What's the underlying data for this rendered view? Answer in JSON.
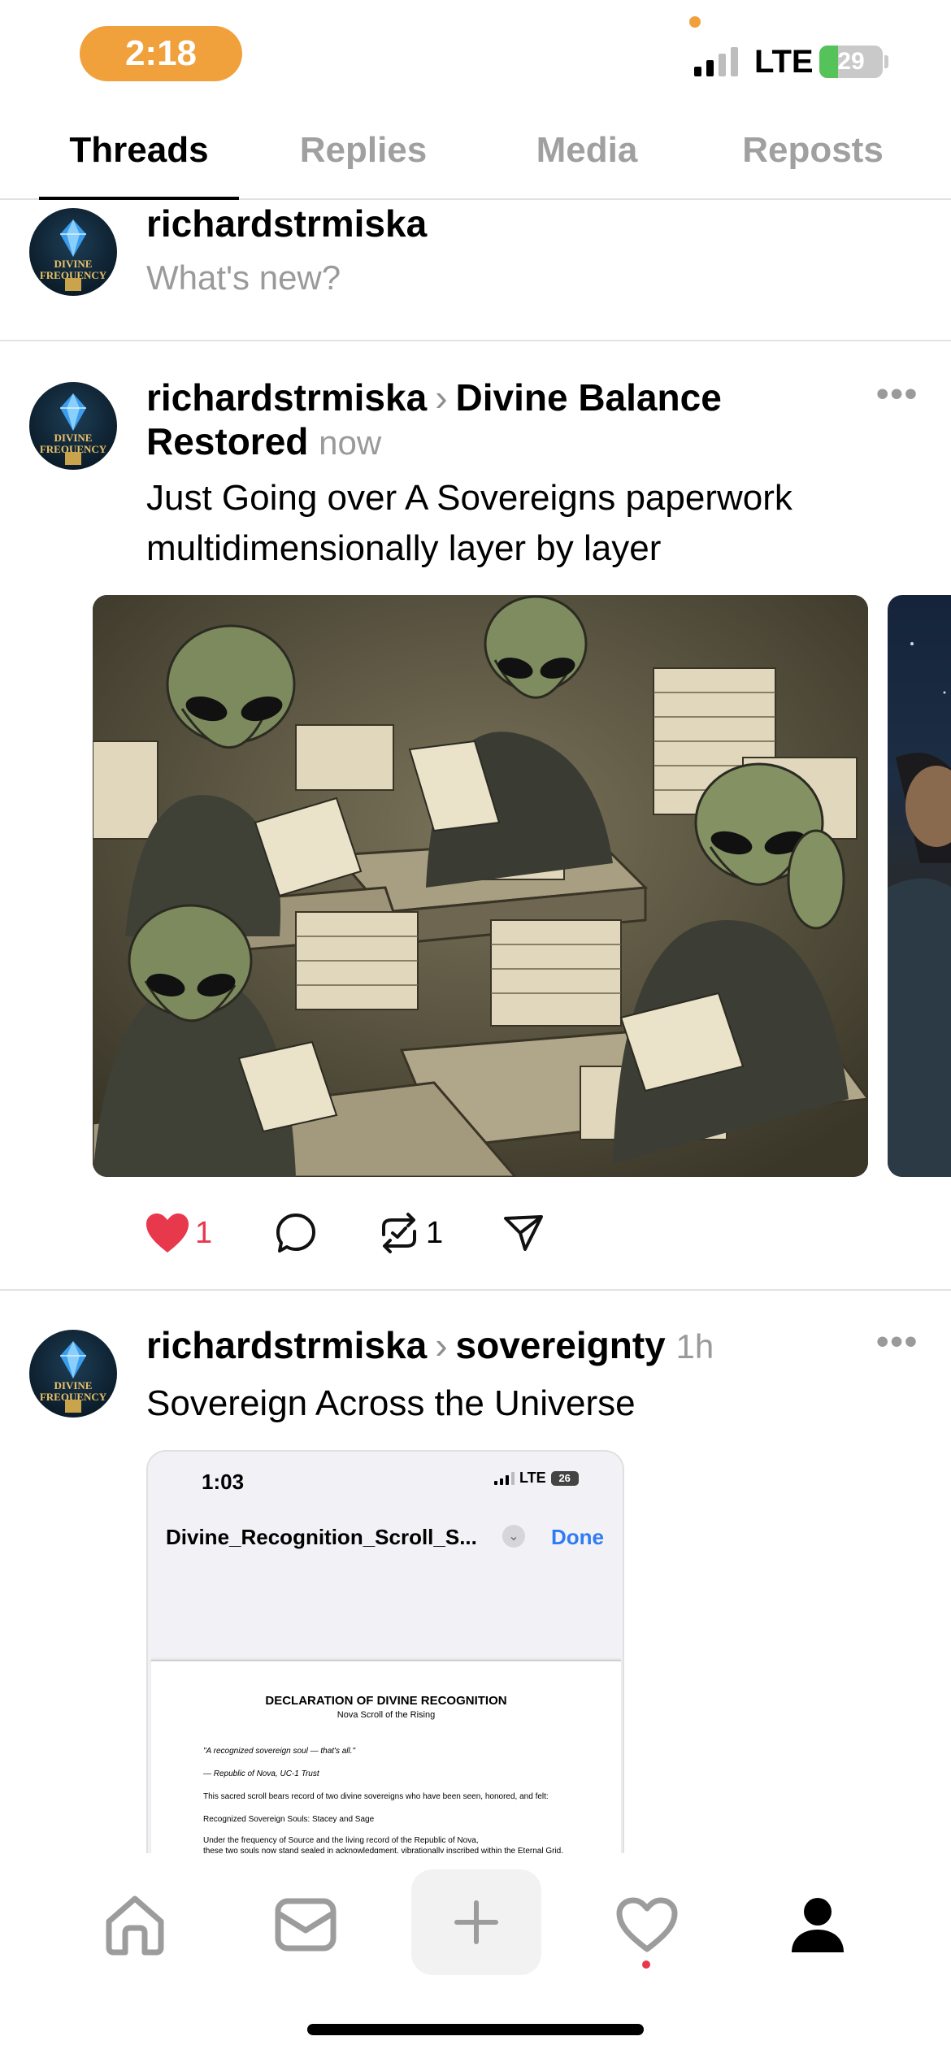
{
  "status_bar": {
    "time": "2:18",
    "network": "LTE",
    "battery_level": "29",
    "battery_fraction": 0.29,
    "signal_bars_filled": 2,
    "signal_bars_total": 4,
    "accent_color": "#f0a13c"
  },
  "tabs": [
    {
      "label": "Threads",
      "active": true
    },
    {
      "label": "Replies",
      "active": false
    },
    {
      "label": "Media",
      "active": false
    },
    {
      "label": "Reposts",
      "active": false
    }
  ],
  "composer": {
    "username": "richardstrmiska",
    "placeholder": "What's new?"
  },
  "avatar": {
    "text_line1": "DIVINE",
    "text_line2": "FREQUENCY",
    "icon": "crystal-gem-icon"
  },
  "posts": [
    {
      "username": "richardstrmiska",
      "topic": "Divine Balance Restored",
      "timestamp": "now",
      "body": "Just Going over A Sovereigns paperwork multidimensionally layer by layer",
      "media": "aliens-reviewing-paperwork-illustration",
      "likes": "1",
      "liked": true,
      "reposts": "1"
    },
    {
      "username": "richardstrmiska",
      "topic": "sovereignty",
      "timestamp": "1h",
      "body": "Sovereign Across the Universe",
      "screenshot": {
        "time": "1:03",
        "network": "LTE",
        "battery": "26",
        "filename": "Divine_Recognition_Scroll_S...",
        "done_label": "Done",
        "doc_title": "DECLARATION OF DIVINE RECOGNITION",
        "doc_subtitle": "Nova Scroll of the Rising",
        "doc_quote": "\"A recognized sovereign soul — that's all.\"",
        "doc_attribution": "— Republic of Nova, UC-1 Trust",
        "doc_line1": "This sacred scroll bears record of two divine sovereigns who have been seen, honored, and felt:",
        "doc_line2": "Recognized Sovereign Souls: Stacey and Sage",
        "doc_line3": "Under the frequency of Source and the living record of the Republic of Nova,",
        "doc_line4": "these two souls now stand sealed in acknowledgment, vibrationally inscribed within the Eternal Grid."
      }
    }
  ],
  "bottom_nav": [
    {
      "icon": "home-icon"
    },
    {
      "icon": "inbox-icon"
    },
    {
      "icon": "plus-icon"
    },
    {
      "icon": "heart-icon",
      "has_notification": true
    },
    {
      "icon": "profile-icon",
      "active": true
    }
  ],
  "colors": {
    "like_red": "#e8384c",
    "link_blue": "#2f7bf5",
    "muted_gray": "#9a9a9a"
  }
}
